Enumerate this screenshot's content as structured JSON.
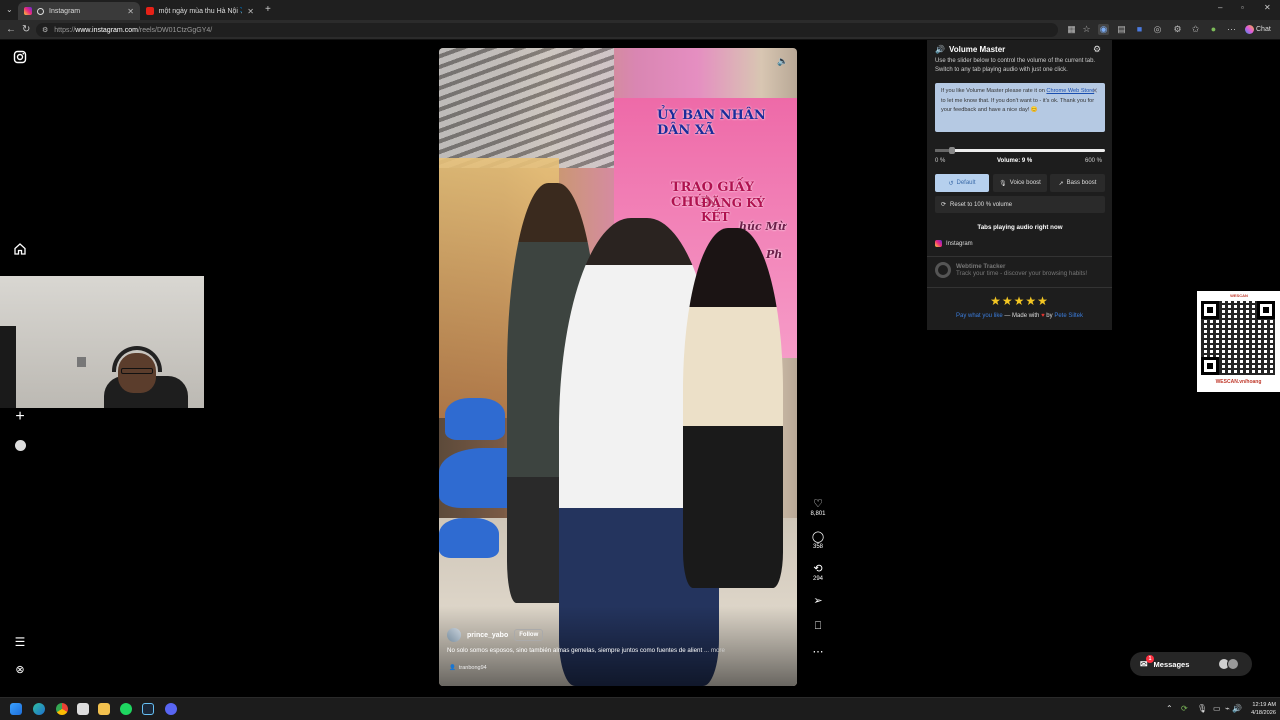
{
  "browser": {
    "tabs": [
      {
        "label": "Instagram",
        "active": true
      },
      {
        "label": "một ngày mùa thu Hà Nội ✈️ - YouTube",
        "active": false
      }
    ],
    "new_tab_icon": "plus-icon",
    "url_prefix": "https://",
    "url_host": "www.instagram.com",
    "url_path": "/reels/DW01CtzGgGY4/",
    "chat_label": "Chat"
  },
  "instagram": {
    "reel": {
      "overlay_line1": "ỦY BAN NHÂN DÂN XÃ",
      "overlay_line2": "TRAO GIẤY CHỨN",
      "overlay_line3": "ĐĂNG KÝ KẾT",
      "overlay_line4": "húc Mừ",
      "overlay_line5": "anh Ph",
      "username": "prince_yabo",
      "follow_label": "Follow",
      "caption": "No solo somos esposos, sino también almas gemelas, siempre juntos como fuentes de alient",
      "more_label": "... more",
      "tagged_user": "tranbong94"
    },
    "actions": {
      "likes": "8,801",
      "comments": "358",
      "reposts": "294"
    },
    "messages_label": "Messages",
    "messages_badge": "1"
  },
  "volume_master": {
    "title": "Volume Master",
    "description": "Use the slider below to control the volume of the current tab. Switch to any tab playing audio with just one click.",
    "notice_pre": "If you like Volume Master please rate it on",
    "notice_link": "Chrome Web Store",
    "notice_post": "to let me know that. If you don't want to - it's ok. Thank you for your feedback and have a nice day! 😊",
    "slider_min": "0 %",
    "slider_max": "600 %",
    "volume_label": "Volume: 9 %",
    "volume_percent": 9,
    "volume_max_percent": 600,
    "btn_default": "Default",
    "btn_voice": "Voice boost",
    "btn_bass": "Bass boost",
    "reset_label": "Reset to 100 % volume",
    "tabs_heading": "Tabs playing audio right now",
    "tab_item": "Instagram",
    "webtime_title": "Webtime Tracker",
    "webtime_desc": "Track your time - discover your browsing habits!",
    "footer_pay": "Pay what you like",
    "footer_made": "— Made with",
    "footer_heart": "♥",
    "footer_by": "by",
    "footer_author": "Pete Siltek",
    "stars": "★★★★★",
    "accent_color": "#3b7ddd"
  },
  "qr": {
    "brand_top": "WESCAN",
    "caption": "WESCAN.vn/hoang"
  },
  "taskbar": {
    "time": "12:19 AM",
    "date": "4/18/2026"
  }
}
